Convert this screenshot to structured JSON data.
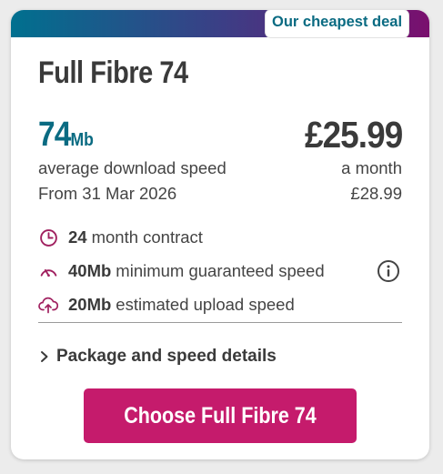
{
  "badge": "Our cheapest deal",
  "plan": {
    "title": "Full Fibre 74",
    "speed_value": "74",
    "speed_unit": "Mb",
    "speed_caption": "average download speed",
    "start_date": "From 31 Mar 2026",
    "price": "£25.99",
    "price_period": "a month",
    "old_price": "£28.99"
  },
  "features": [
    {
      "icon": "clock-icon",
      "bold": "24",
      "text": "month contract"
    },
    {
      "icon": "speedometer-icon",
      "bold": "40Mb",
      "text": "minimum guaranteed speed"
    },
    {
      "icon": "upload-cloud-icon",
      "bold": "20Mb",
      "text": "estimated upload speed"
    }
  ],
  "details_link": "Package and speed details",
  "cta_label": "Choose Full Fibre 74",
  "colors": {
    "accent_teal": "#0a6b82",
    "cta_pink": "#c51b6c",
    "icon_plum": "#a0205f",
    "gradient": [
      "#00708f",
      "#3b3f86",
      "#7a0f6e"
    ]
  }
}
